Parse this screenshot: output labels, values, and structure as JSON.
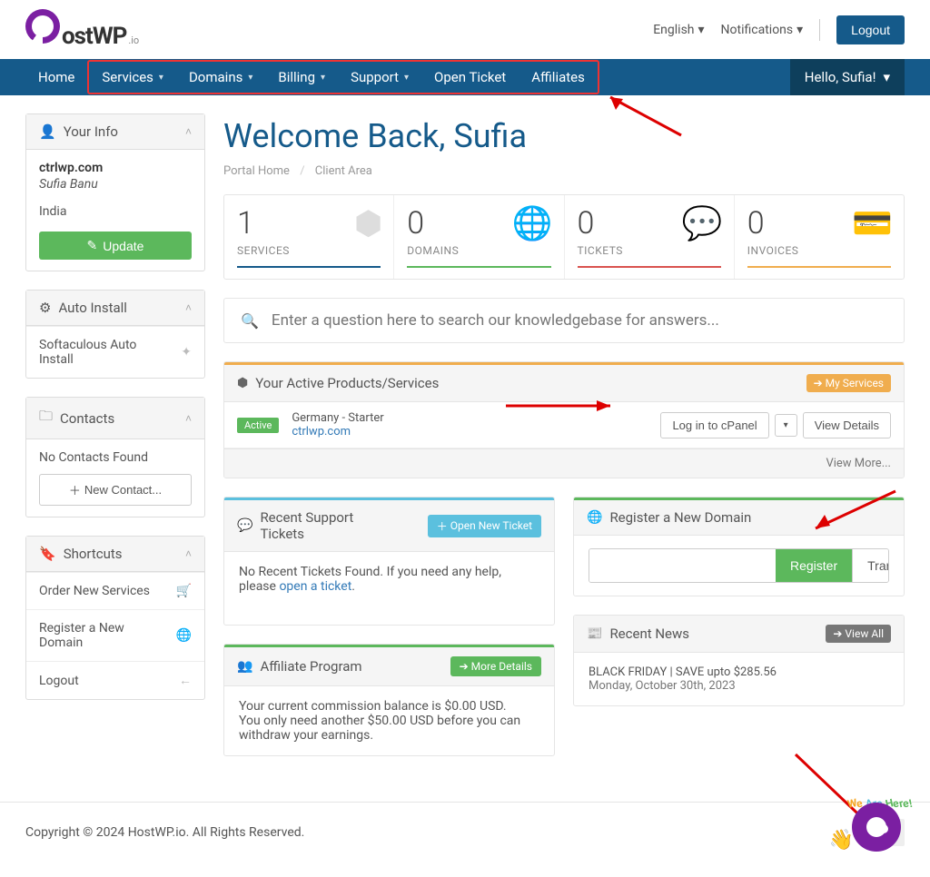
{
  "topbar": {
    "logo_text": "ostWP",
    "logo_sub": ".io",
    "language": "English",
    "notifications": "Notifications",
    "logout": "Logout"
  },
  "nav": {
    "home": "Home",
    "services": "Services",
    "domains": "Domains",
    "billing": "Billing",
    "support": "Support",
    "open_ticket": "Open Ticket",
    "affiliates": "Affiliates",
    "greeting": "Hello, Sufia!"
  },
  "sidebar": {
    "your_info": {
      "title": "Your Info",
      "domain": "ctrlwp.com",
      "user": "Sufia Banu",
      "country": "India",
      "update": "Update"
    },
    "auto_install": {
      "title": "Auto Install",
      "item": "Softaculous Auto Install"
    },
    "contacts": {
      "title": "Contacts",
      "empty": "No Contacts Found",
      "new": "New Contact..."
    },
    "shortcuts": {
      "title": "Shortcuts",
      "order": "Order New Services",
      "register": "Register a New Domain",
      "logout": "Logout"
    }
  },
  "main": {
    "title": "Welcome Back, Sufia",
    "breadcrumb": {
      "home": "Portal Home",
      "current": "Client Area"
    },
    "stats": [
      {
        "num": "1",
        "label": "SERVICES",
        "color": "#155a8a"
      },
      {
        "num": "0",
        "label": "DOMAINS",
        "color": "#5cb85c"
      },
      {
        "num": "0",
        "label": "TICKETS",
        "color": "#d9534f"
      },
      {
        "num": "0",
        "label": "INVOICES",
        "color": "#f0ad4e"
      }
    ],
    "search_placeholder": "Enter a question here to search our knowledgebase for answers...",
    "active_services": {
      "title": "Your Active Products/Services",
      "my_services": "My Services",
      "status": "Active",
      "product": "Germany - Starter",
      "domain": "ctrlwp.com",
      "login": "Log in to cPanel",
      "view": "View Details",
      "more": "View More..."
    },
    "tickets": {
      "title": "Recent Support Tickets",
      "open_new": "Open New Ticket",
      "text1": "No Recent Tickets Found. If you need any help, please ",
      "link": "open a ticket",
      "text2": "."
    },
    "register": {
      "title": "Register a New Domain",
      "register": "Register",
      "transfer": "Transfer"
    },
    "affiliate": {
      "title": "Affiliate Program",
      "more": "More Details",
      "line1": "Your current commission balance is $0.00 USD.",
      "line2": "You only need another $50.00 USD before you can withdraw your earnings."
    },
    "news": {
      "title": "Recent News",
      "view_all": "View All",
      "item_title": "BLACK FRIDAY | SAVE upto $285.56",
      "item_date": "Monday, October 30th, 2023"
    }
  },
  "footer": {
    "text": "Copyright © 2024 HostWP.io. All Rights Reserved."
  },
  "chat": {
    "badge": "We Are Here!"
  }
}
